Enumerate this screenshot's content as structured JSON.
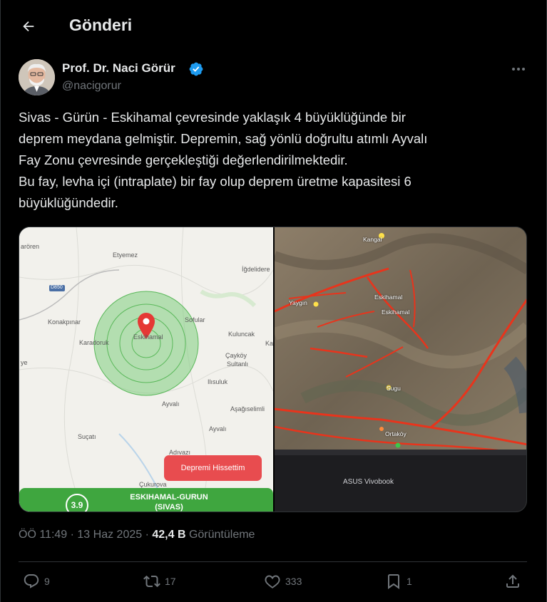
{
  "header": {
    "title": "Gönderi"
  },
  "author": {
    "name": "Prof. Dr. Naci Görür",
    "handle": "@nacigorur"
  },
  "tweet": {
    "lines": [
      "Sivas - Gürün - Eskihamal çevresinde yaklaşık 4 büyüklüğünde bir",
      "deprem meydana gelmiştir. Depremin, sağ yönlü doğrultu atımlı Ayvalı",
      "Fay Zonu çevresinde gerçekleştiği değerlendirilmektedir.",
      "Bu fay, levha içi (intraplate) bir fay olup deprem üretme kapasitesi 6",
      "büyüklüğündedir."
    ]
  },
  "media": {
    "left_map": {
      "labels": {
        "aroren": "arören",
        "etyemez": "Etyemez",
        "igdeliderel": "İğdelidere",
        "road": "D850",
        "sofular": "Sofular",
        "konakpinar": "Konakpınar",
        "kuluncak": "Kuluncak",
        "karadoruk": "Karadoruk",
        "eskihamal": "Eskihamal",
        "caykoy": "Çayköy",
        "sultanli": "Sultanlı",
        "ye": "ye",
        "ilisuluk": "Ilısuluk",
        "ayvali1": "Ayvalı",
        "asagiselimli": "Aşağıselimli",
        "sucati": "Suçatı",
        "ayvali2": "Ayvalı",
        "adivazi": "Adıvazı",
        "cukurova": "Çukurova",
        "ka": "Ka"
      },
      "button": "Depremi Hissettim",
      "magnitude": "3.9",
      "location_line1": "ESKIHAMAL-GURUN",
      "location_line2": "(SIVAS)"
    },
    "right_photo": {
      "labels": {
        "kangal": "Kangal",
        "eskihamal1": "Eskihamal",
        "eskihamal2": "Eskihamal",
        "yaygin": "Yaygın",
        "sugu": "Sugu",
        "ortakoy": "Ortaköy"
      },
      "laptop_brand": "ASUS Vivobook"
    }
  },
  "meta": {
    "time": "ÖÖ 11:49",
    "sep1": " · ",
    "date": "13 Haz 2025",
    "sep2": " · ",
    "views_count": "42,4 B",
    "views_label": " Görüntüleme"
  },
  "actions": {
    "replies": "9",
    "reposts": "17",
    "likes": "333",
    "bookmarks": "1"
  },
  "colors": {
    "background": "#000000",
    "text": "#e7e9ea",
    "secondary": "#71767b",
    "verified": "#1d9bf0",
    "quake_green": "#3fa63f",
    "button_red": "#e84c4f"
  }
}
